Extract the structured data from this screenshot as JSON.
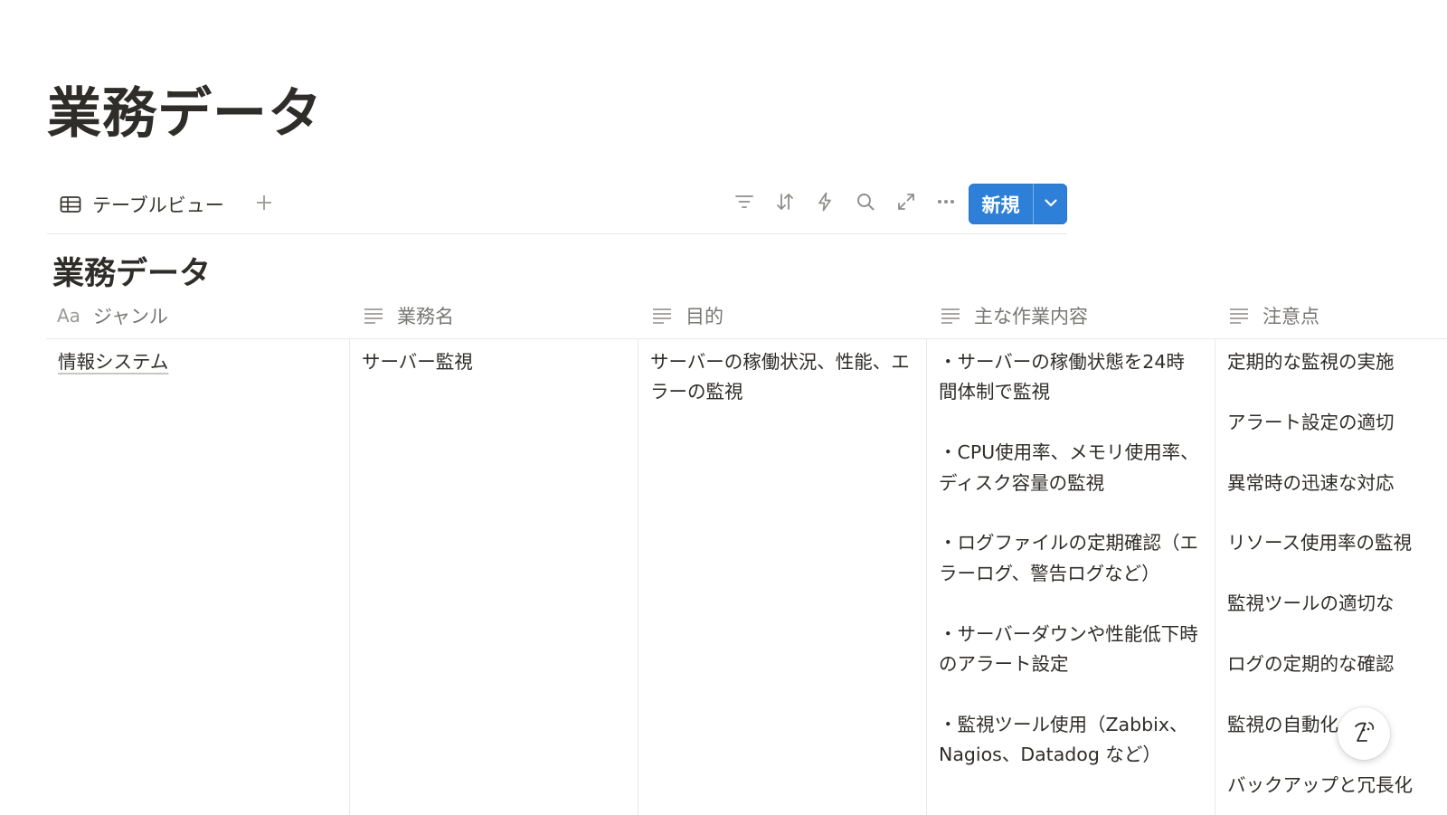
{
  "page": {
    "title": "業務データ"
  },
  "viewbar": {
    "view_tab_label": "テーブルビュー",
    "view_tab_icon": "table-icon",
    "add_view_icon": "plus-icon",
    "tools": [
      "filter-icon",
      "sort-icon",
      "automation-bolt-icon",
      "search-icon",
      "expand-icon",
      "more-icon"
    ],
    "new_label": "新規",
    "new_dropdown_icon": "chevron-down-icon",
    "accent_color": "#2e7fd8"
  },
  "database": {
    "title": "業務データ",
    "columns": [
      {
        "icon": "title-aa-icon",
        "icon_text": "Aa",
        "label": "ジャンル"
      },
      {
        "icon": "text-lines-icon",
        "label": "業務名"
      },
      {
        "icon": "text-lines-icon",
        "label": "目的"
      },
      {
        "icon": "text-lines-icon",
        "label": "主な作業内容"
      },
      {
        "icon": "text-lines-icon",
        "label": "注意点"
      }
    ],
    "rows": [
      {
        "genre": "情報システム",
        "task_name": "サーバー監視",
        "purpose": "サーバーの稼働状況、性能、エラーの監視",
        "main_work": [
          "・サーバーの稼働状態を24時間体制で監視",
          "・CPU使用率、メモリ使用率、ディスク容量の監視",
          "・ログファイルの定期確認（エラーログ、警告ログなど）",
          "・サーバーダウンや性能低下時のアラート設定",
          "・監視ツール使用（Zabbix、Nagios、Datadog など）"
        ],
        "notes": [
          "定期的な監視の実施",
          "アラート設定の適切",
          "異常時の迅速な対応",
          "リソース使用率の監視",
          "監視ツールの適切な",
          "ログの定期的な確認",
          "監視の自動化",
          "バックアップと冗長化"
        ]
      }
    ]
  },
  "help": {
    "icon": "help-assistant-icon"
  }
}
